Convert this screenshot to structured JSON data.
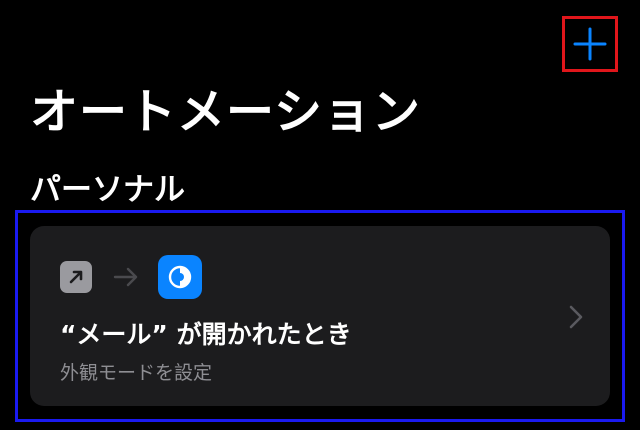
{
  "header": {
    "add_icon": "plus-icon",
    "accent_color": "#0a84ff"
  },
  "title": "オートメーション",
  "section": {
    "title": "パーソナル"
  },
  "automation": {
    "trigger_icon": "arrow-up-right-icon",
    "flow_icon": "arrow-right-icon",
    "action_icon": "appearance-icon",
    "title": "“メール” が開かれたとき",
    "subtitle": "外観モードを設定",
    "chevron_icon": "chevron-right-icon"
  }
}
